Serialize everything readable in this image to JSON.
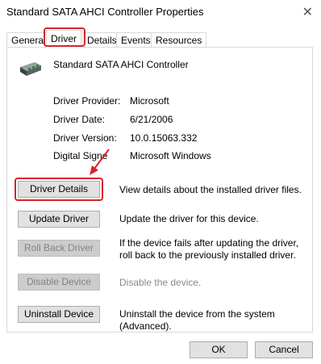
{
  "window": {
    "title": "Standard SATA AHCI Controller Properties",
    "close_glyph": "✕"
  },
  "tabs": [
    {
      "label": "General"
    },
    {
      "label": "Driver"
    },
    {
      "label": "Details"
    },
    {
      "label": "Events"
    },
    {
      "label": "Resources"
    }
  ],
  "active_tab": "Driver",
  "device": {
    "name": "Standard SATA AHCI Controller",
    "icon": "storage-controller-icon"
  },
  "info": [
    {
      "label": "Driver Provider:",
      "value": "Microsoft"
    },
    {
      "label": "Driver Date:",
      "value": "6/21/2006"
    },
    {
      "label": "Driver Version:",
      "value": "10.0.15063.332"
    },
    {
      "label": "Digital Signe",
      "value": "Microsoft Windows"
    }
  ],
  "actions": [
    {
      "label": "Driver Details",
      "description": "View details about the installed driver files."
    },
    {
      "label": "Update Driver",
      "description": "Update the driver for this device."
    },
    {
      "label": "Roll Back Driver",
      "description": "If the device fails after updating the driver, roll back to the previously installed driver."
    },
    {
      "label": "Disable Device",
      "description": "Disable the device."
    },
    {
      "label": "Uninstall Device",
      "description": "Uninstall the device from the system (Advanced)."
    }
  ],
  "footer": {
    "ok_label": "OK",
    "cancel_label": "Cancel"
  },
  "colors": {
    "highlight": "#d6242a",
    "button_bg": "#e1e1e1",
    "disabled_text": "#838383"
  }
}
